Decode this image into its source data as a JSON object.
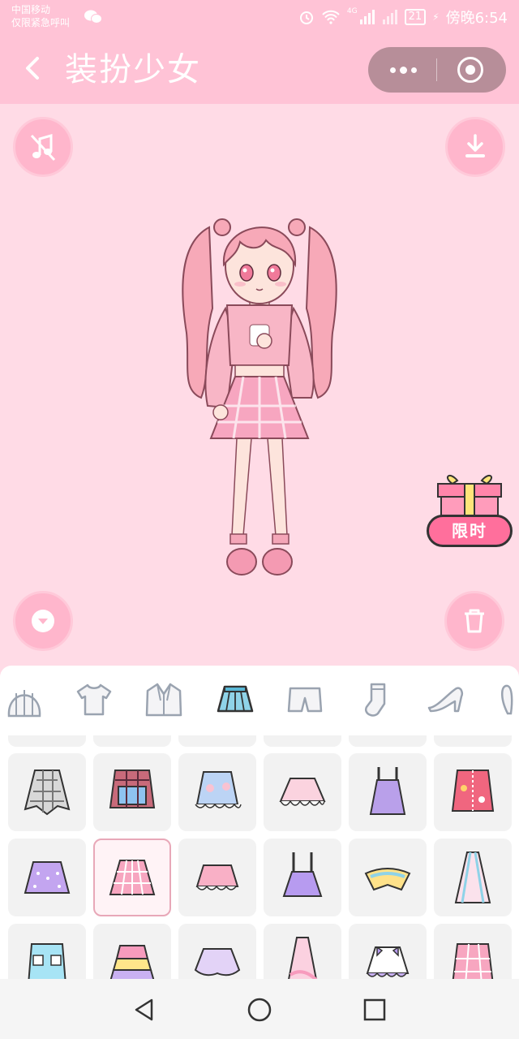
{
  "status_bar": {
    "carrier": "中国移动",
    "emergency": "仅限紧急呼叫",
    "network": "4G",
    "battery": "21",
    "time": "傍晚6:54"
  },
  "title_bar": {
    "title": "装扮少女"
  },
  "controls": {
    "music_icon": "music-off-icon",
    "download_icon": "download-icon",
    "collapse_icon": "chevron-down-icon",
    "delete_icon": "trash-icon"
  },
  "gift": {
    "label": "限时"
  },
  "categories": [
    {
      "name": "hat"
    },
    {
      "name": "top"
    },
    {
      "name": "jacket"
    },
    {
      "name": "skirt",
      "selected": true
    },
    {
      "name": "shorts"
    },
    {
      "name": "socks"
    },
    {
      "name": "shoes"
    },
    {
      "name": "accessory"
    }
  ],
  "items": [
    {
      "name": "plaid-tied-skirt"
    },
    {
      "name": "flannel-tied-skirt"
    },
    {
      "name": "blue-frill-skirt"
    },
    {
      "name": "pink-tutu-skirt"
    },
    {
      "name": "purple-overall-dress"
    },
    {
      "name": "red-denim-skirt"
    },
    {
      "name": "lavender-dot-skirt"
    },
    {
      "name": "pink-plaid-pleated-skirt",
      "selected": true
    },
    {
      "name": "pink-frill-skirt"
    },
    {
      "name": "purple-suspender-skirt"
    },
    {
      "name": "yellow-petal-skirt"
    },
    {
      "name": "striped-long-skirt"
    },
    {
      "name": "blue-pocket-skirt"
    },
    {
      "name": "rainbow-tier-skirt"
    },
    {
      "name": "lilac-tutu-skirt"
    },
    {
      "name": "pink-long-skirt"
    },
    {
      "name": "bow-frill-skirt"
    },
    {
      "name": "pink-check-skirt"
    }
  ],
  "colors": {
    "background": "#ffdbe6",
    "header": "#ffc3d6",
    "button": "#ffb6cc",
    "gift_label": "#ff6f9c"
  }
}
